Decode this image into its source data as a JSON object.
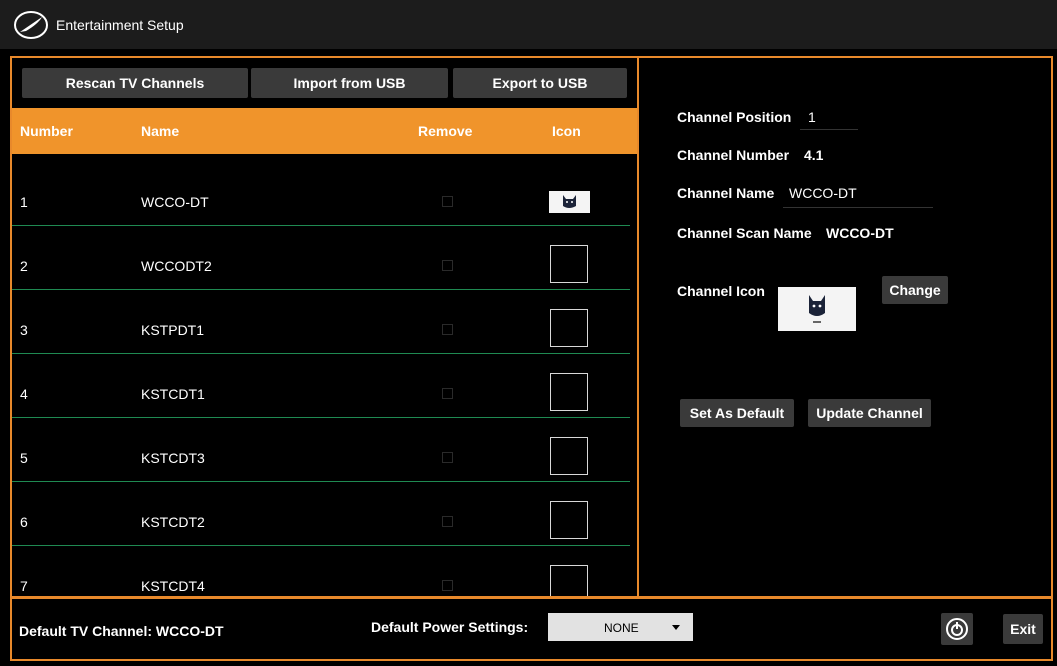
{
  "app": {
    "title": "Entertainment Setup"
  },
  "toolbar": {
    "rescan_label": "Rescan TV Channels",
    "import_label": "Import from USB",
    "export_label": "Export to USB"
  },
  "table": {
    "columns": [
      "Number",
      "Name",
      "Remove",
      "Icon"
    ],
    "rows": [
      {
        "number": "1",
        "name": "WCCO-DT",
        "remove": false,
        "icon": "cat-logo-icon"
      },
      {
        "number": "2",
        "name": "WCCODT2",
        "remove": false,
        "icon": "empty-icon-box"
      },
      {
        "number": "3",
        "name": "KSTPDT1",
        "remove": false,
        "icon": "empty-icon-box"
      },
      {
        "number": "4",
        "name": "KSTCDT1",
        "remove": false,
        "icon": "empty-icon-box"
      },
      {
        "number": "5",
        "name": "KSTCDT3",
        "remove": false,
        "icon": "empty-icon-box"
      },
      {
        "number": "6",
        "name": "KSTCDT2",
        "remove": false,
        "icon": "empty-icon-box"
      },
      {
        "number": "7",
        "name": "KSTCDT4",
        "remove": false,
        "icon": "empty-icon-box"
      }
    ]
  },
  "details": {
    "position_label": "Channel Position",
    "position_value": "1",
    "number_label": "Channel Number",
    "number_value": "4.1",
    "name_label": "Channel Name",
    "name_value": "WCCO-DT",
    "scan_name_label": "Channel Scan Name",
    "scan_name_value": "WCCO-DT",
    "icon_label": "Channel Icon",
    "change_label": "Change",
    "set_default_label": "Set As Default",
    "update_label": "Update Channel"
  },
  "footer": {
    "default_channel_text": "Default TV Channel: WCCO-DT",
    "power_label": "Default Power Settings:",
    "power_value": "NONE",
    "exit_label": "Exit"
  },
  "colors": {
    "accent": "#f0942b",
    "border": "#e8892b",
    "row_separator": "#1f8a52",
    "button": "#3a3a3a"
  }
}
